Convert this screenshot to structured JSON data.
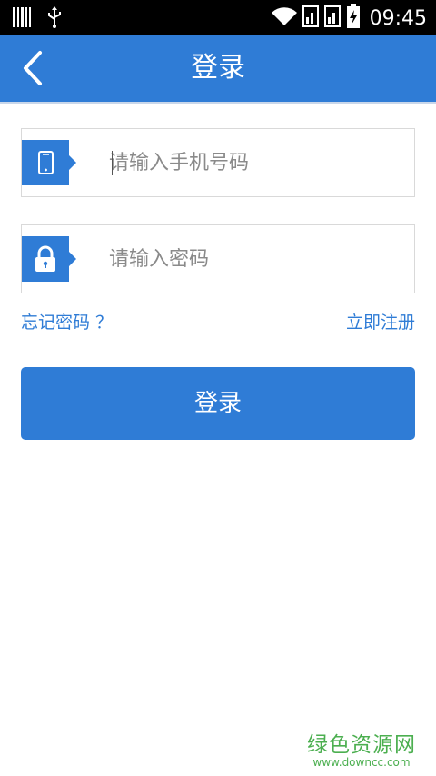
{
  "status_bar": {
    "time": "09:45",
    "icons": [
      "barcode-icon",
      "usb-icon",
      "wifi-icon",
      "sim-signal-icon",
      "sim-signal-icon",
      "battery-charging-icon"
    ]
  },
  "app_bar": {
    "title": "登录",
    "back_icon": "chevron-left-icon"
  },
  "form": {
    "phone": {
      "placeholder": "请输入手机号码",
      "value": "",
      "icon": "mobile-phone-icon"
    },
    "password": {
      "placeholder": "请输入密码",
      "value": "",
      "icon": "lock-icon"
    },
    "forgot_password": "忘记密码 ？",
    "register": "立即注册",
    "login_button": "登录"
  },
  "watermark": {
    "main": "绿色资源网",
    "sub": "www.downcc.com"
  },
  "colors": {
    "accent": "#2f7cd6",
    "status_bar": "#000000",
    "watermark": "#4caf50"
  }
}
